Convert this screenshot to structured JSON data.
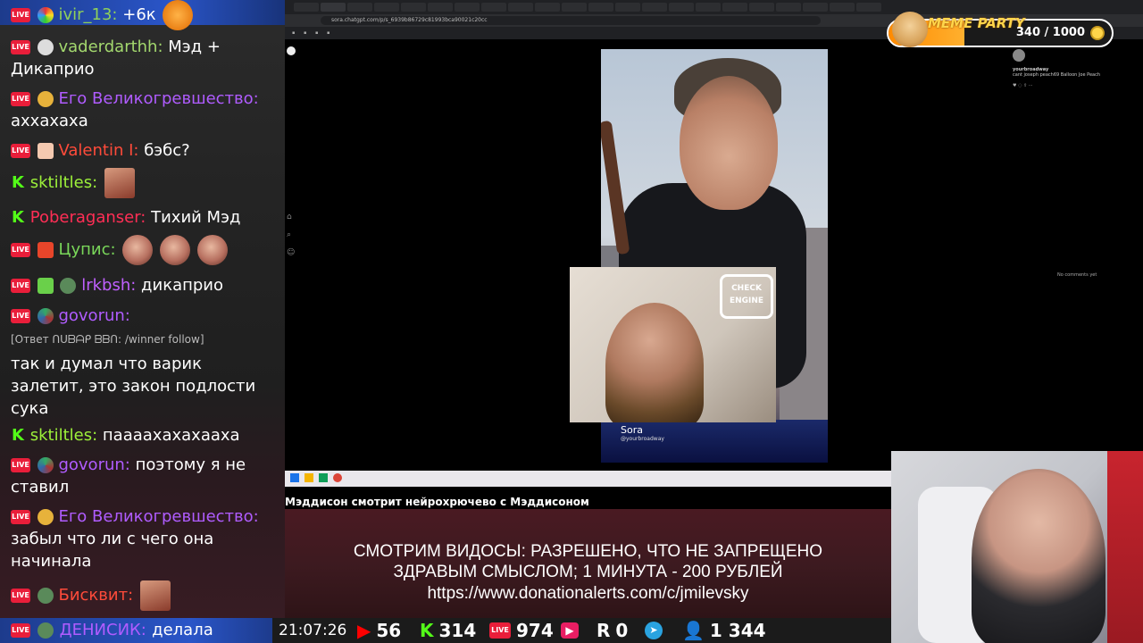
{
  "chat": {
    "messages": [
      {
        "user": "ivir_13:",
        "user_color": "#8fd05a",
        "text": "+6к"
      },
      {
        "user": "vaderdarthh:",
        "user_color": "#a3d86e",
        "text": "Мэд + Дикаприо"
      },
      {
        "user": "Его Великогревшество:",
        "user_color": "#b05cff",
        "text": "аххахаха"
      },
      {
        "user": "Valentin I:",
        "user_color": "#ff4b3a",
        "text": "бэбс?"
      },
      {
        "user": "sktiltles:",
        "user_color": "#9cf03a",
        "text": ""
      },
      {
        "user": "Poberaganser:",
        "user_color": "#ff2e55",
        "text": "Тихий Мэд"
      },
      {
        "user": "Цупис:",
        "user_color": "#7ad85a",
        "text": ""
      },
      {
        "user": "lrkbsh:",
        "user_color": "#c060ff",
        "text": "дикаприо"
      },
      {
        "user": "govorun:",
        "user_color": "#b05cff",
        "text": ""
      },
      {
        "reply": "[Ответ ᑎᑌᗷᗩᑭ ᗷᗷᑎ: /winner follow]",
        "text": "так и думал что варик залетит, это закон подлости сука"
      },
      {
        "user": "sktiltles:",
        "user_color": "#9cf03a",
        "text": "паааахахахааха"
      },
      {
        "user": "govorun:",
        "user_color": "#b05cff",
        "text": "поэтому я не ставил"
      },
      {
        "user": "Его Великогревшество:",
        "user_color": "#b05cff",
        "text": "забыл что ли с чего она начинала"
      },
      {
        "user": "Бисквит:",
        "user_color": "#ff4b3a",
        "text": ""
      },
      {
        "user": "ДЕНИСИК:",
        "user_color": "#b05cff",
        "text": "делала"
      }
    ]
  },
  "ticker": {
    "time": "21:07:26",
    "youtube": "56",
    "kick": "314",
    "live": "974",
    "rutube": "0",
    "telegram": "",
    "viewers": "1 344"
  },
  "browser": {
    "url": "sora.chatgpt.com/p/s_6939b86729c81993bca90021c20cc",
    "sora_label": "Sora",
    "sora_handle": "@yourbroadway",
    "comment_user": "yourbroadway",
    "comment_text": "cant joseph peach69 Balloon Joe Peach",
    "no_comments": "No comments yet",
    "caption": "Мэддисон смотрит нейрохрючево с Мэддисоном",
    "cam_sign": "CHECK ENGINE"
  },
  "banner": {
    "line1": "СМОТРИМ ВИДОСЫ: РАЗРЕШЕНО, ЧТО НЕ ЗАПРЕЩЕНО",
    "line2": "ЗДРАВЫМ СМЫСЛОМ; 1 МИНУТА - 200 РУБЛЕЙ",
    "line3": "https://www.donationalerts.com/c/jmilevsky"
  },
  "meme_party": {
    "title": "MEME PARTY",
    "count": "340 / 1000",
    "progress": 0.34
  }
}
